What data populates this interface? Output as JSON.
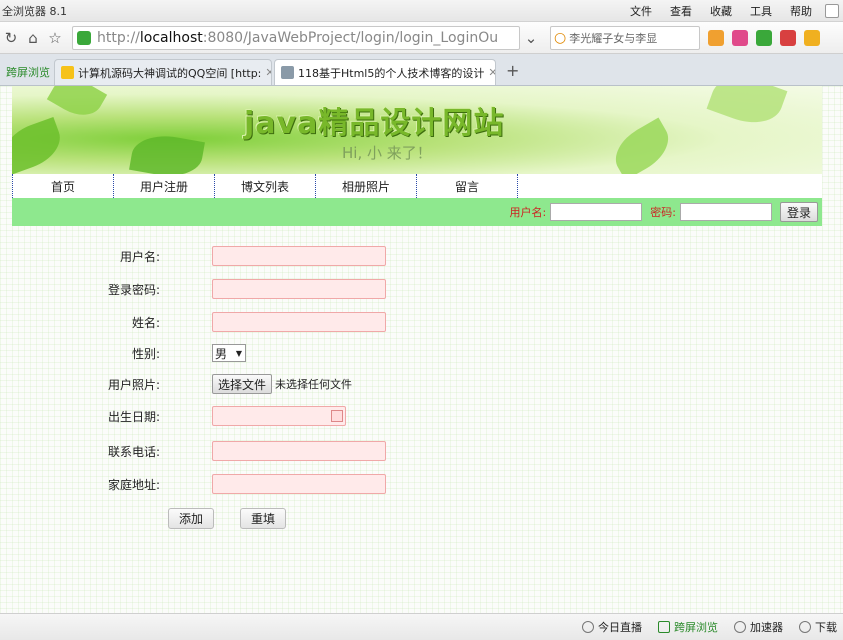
{
  "browser": {
    "app_name": "全浏览器 8.1",
    "menu": [
      "文件",
      "查看",
      "收藏",
      "工具",
      "帮助"
    ],
    "url_prefix": "http://",
    "url_host": "localhost",
    "url_rest": ":8080/JavaWebProject/login/login_LoginOu",
    "search_text": "李光耀子女与李显",
    "tabs": [
      {
        "label": "跨屏浏览"
      },
      {
        "label": "计算机源码大神调试的QQ空间 [http:"
      },
      {
        "label": "118基于Html5的个人技术博客的设计"
      }
    ],
    "status_items": [
      "今日直播",
      "跨屏浏览",
      "加速器",
      "下载"
    ]
  },
  "site": {
    "title": "java精品设计网站",
    "subtitle": "Hi, 小 来了！",
    "nav": [
      "首页",
      "用户注册",
      "博文列表",
      "相册照片",
      "留言"
    ],
    "login": {
      "username_label": "用户名:",
      "password_label": "密码:",
      "button": "登录"
    }
  },
  "form": {
    "username_label": "用户名:",
    "password_label": "登录密码:",
    "name_label": "姓名:",
    "gender_label": "性别:",
    "gender_value": "男",
    "photo_label": "用户照片:",
    "file_button": "选择文件",
    "file_status": "未选择任何文件",
    "birthday_label": "出生日期:",
    "phone_label": "联系电话:",
    "address_label": "家庭地址:",
    "add_button": "添加",
    "reset_button": "重填"
  },
  "colors": {
    "login_bar": "#8ee88e",
    "field_bg": "#ffeaea",
    "field_border": "#f0a8a8",
    "nav_divider": "#2b4aa8"
  }
}
